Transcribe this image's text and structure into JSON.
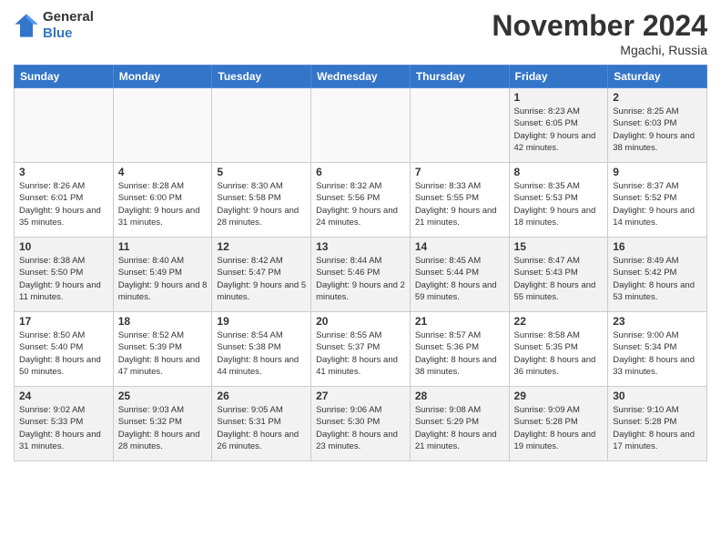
{
  "header": {
    "logo_line1": "General",
    "logo_line2": "Blue",
    "month": "November 2024",
    "location": "Mgachi, Russia"
  },
  "days_of_week": [
    "Sunday",
    "Monday",
    "Tuesday",
    "Wednesday",
    "Thursday",
    "Friday",
    "Saturday"
  ],
  "weeks": [
    [
      {
        "day": "",
        "info": ""
      },
      {
        "day": "",
        "info": ""
      },
      {
        "day": "",
        "info": ""
      },
      {
        "day": "",
        "info": ""
      },
      {
        "day": "",
        "info": ""
      },
      {
        "day": "1",
        "info": "Sunrise: 8:23 AM\nSunset: 6:05 PM\nDaylight: 9 hours and 42 minutes."
      },
      {
        "day": "2",
        "info": "Sunrise: 8:25 AM\nSunset: 6:03 PM\nDaylight: 9 hours and 38 minutes."
      }
    ],
    [
      {
        "day": "3",
        "info": "Sunrise: 8:26 AM\nSunset: 6:01 PM\nDaylight: 9 hours and 35 minutes."
      },
      {
        "day": "4",
        "info": "Sunrise: 8:28 AM\nSunset: 6:00 PM\nDaylight: 9 hours and 31 minutes."
      },
      {
        "day": "5",
        "info": "Sunrise: 8:30 AM\nSunset: 5:58 PM\nDaylight: 9 hours and 28 minutes."
      },
      {
        "day": "6",
        "info": "Sunrise: 8:32 AM\nSunset: 5:56 PM\nDaylight: 9 hours and 24 minutes."
      },
      {
        "day": "7",
        "info": "Sunrise: 8:33 AM\nSunset: 5:55 PM\nDaylight: 9 hours and 21 minutes."
      },
      {
        "day": "8",
        "info": "Sunrise: 8:35 AM\nSunset: 5:53 PM\nDaylight: 9 hours and 18 minutes."
      },
      {
        "day": "9",
        "info": "Sunrise: 8:37 AM\nSunset: 5:52 PM\nDaylight: 9 hours and 14 minutes."
      }
    ],
    [
      {
        "day": "10",
        "info": "Sunrise: 8:38 AM\nSunset: 5:50 PM\nDaylight: 9 hours and 11 minutes."
      },
      {
        "day": "11",
        "info": "Sunrise: 8:40 AM\nSunset: 5:49 PM\nDaylight: 9 hours and 8 minutes."
      },
      {
        "day": "12",
        "info": "Sunrise: 8:42 AM\nSunset: 5:47 PM\nDaylight: 9 hours and 5 minutes."
      },
      {
        "day": "13",
        "info": "Sunrise: 8:44 AM\nSunset: 5:46 PM\nDaylight: 9 hours and 2 minutes."
      },
      {
        "day": "14",
        "info": "Sunrise: 8:45 AM\nSunset: 5:44 PM\nDaylight: 8 hours and 59 minutes."
      },
      {
        "day": "15",
        "info": "Sunrise: 8:47 AM\nSunset: 5:43 PM\nDaylight: 8 hours and 55 minutes."
      },
      {
        "day": "16",
        "info": "Sunrise: 8:49 AM\nSunset: 5:42 PM\nDaylight: 8 hours and 53 minutes."
      }
    ],
    [
      {
        "day": "17",
        "info": "Sunrise: 8:50 AM\nSunset: 5:40 PM\nDaylight: 8 hours and 50 minutes."
      },
      {
        "day": "18",
        "info": "Sunrise: 8:52 AM\nSunset: 5:39 PM\nDaylight: 8 hours and 47 minutes."
      },
      {
        "day": "19",
        "info": "Sunrise: 8:54 AM\nSunset: 5:38 PM\nDaylight: 8 hours and 44 minutes."
      },
      {
        "day": "20",
        "info": "Sunrise: 8:55 AM\nSunset: 5:37 PM\nDaylight: 8 hours and 41 minutes."
      },
      {
        "day": "21",
        "info": "Sunrise: 8:57 AM\nSunset: 5:36 PM\nDaylight: 8 hours and 38 minutes."
      },
      {
        "day": "22",
        "info": "Sunrise: 8:58 AM\nSunset: 5:35 PM\nDaylight: 8 hours and 36 minutes."
      },
      {
        "day": "23",
        "info": "Sunrise: 9:00 AM\nSunset: 5:34 PM\nDaylight: 8 hours and 33 minutes."
      }
    ],
    [
      {
        "day": "24",
        "info": "Sunrise: 9:02 AM\nSunset: 5:33 PM\nDaylight: 8 hours and 31 minutes."
      },
      {
        "day": "25",
        "info": "Sunrise: 9:03 AM\nSunset: 5:32 PM\nDaylight: 8 hours and 28 minutes."
      },
      {
        "day": "26",
        "info": "Sunrise: 9:05 AM\nSunset: 5:31 PM\nDaylight: 8 hours and 26 minutes."
      },
      {
        "day": "27",
        "info": "Sunrise: 9:06 AM\nSunset: 5:30 PM\nDaylight: 8 hours and 23 minutes."
      },
      {
        "day": "28",
        "info": "Sunrise: 9:08 AM\nSunset: 5:29 PM\nDaylight: 8 hours and 21 minutes."
      },
      {
        "day": "29",
        "info": "Sunrise: 9:09 AM\nSunset: 5:28 PM\nDaylight: 8 hours and 19 minutes."
      },
      {
        "day": "30",
        "info": "Sunrise: 9:10 AM\nSunset: 5:28 PM\nDaylight: 8 hours and 17 minutes."
      }
    ]
  ]
}
